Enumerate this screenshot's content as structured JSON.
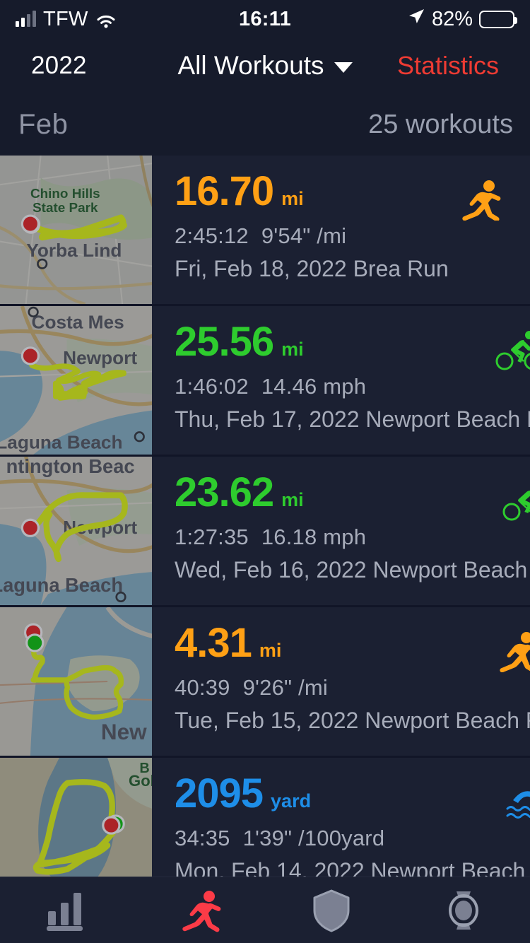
{
  "status_bar": {
    "carrier": "TFW",
    "time": "16:11",
    "battery_percent": "82%",
    "signal_icon": "cellular-bars-icon",
    "wifi_icon": "wifi-icon",
    "location_icon": "location-arrow-icon",
    "battery_icon": "battery-icon"
  },
  "nav": {
    "year": "2022",
    "title": "All Workouts",
    "dropdown_icon": "chevron-down-icon",
    "action": "Statistics",
    "action_color": "#EE3B33"
  },
  "section": {
    "month": "Feb",
    "count": "25 workouts"
  },
  "colors": {
    "run": "#FFA015",
    "bike": "#2ECC2E",
    "swim": "#1E8EE8",
    "accent_red": "#EE3B33",
    "route_track": "#E8FF1A",
    "page_bg": "#111527",
    "row_bg": "#1B2032",
    "bar_bg": "#161B2B",
    "secondary_text": "#A7ACBA"
  },
  "workouts": [
    {
      "distance": "16.70",
      "unit": "mi",
      "duration": "2:45:12",
      "pace": "9'54\" /mi",
      "date": "Fri, Feb 18, 2022",
      "name": "Brea Run",
      "sport": "run",
      "sport_icon": "running-icon",
      "map_labels": [
        "Chino Hills",
        "State Park",
        "Yorba Lind"
      ],
      "markers": [
        "red"
      ]
    },
    {
      "distance": "25.56",
      "unit": "mi",
      "duration": "1:46:02",
      "pace": "14.46 mph",
      "date": "Thu, Feb 17, 2022",
      "name": "Newport Beach Bike",
      "sport": "bike",
      "sport_icon": "cycling-icon",
      "map_labels": [
        "Costa Mes",
        "Newport",
        "Laguna Beach"
      ],
      "markers": [
        "red"
      ]
    },
    {
      "distance": "23.62",
      "unit": "mi",
      "duration": "1:27:35",
      "pace": "16.18 mph",
      "date": "Wed, Feb 16, 2022",
      "name": "Newport Beach Bike",
      "sport": "bike",
      "sport_icon": "cycling-icon",
      "map_labels": [
        "ntington Beac",
        "Newport",
        "Laguna Beach"
      ],
      "markers": [
        "red"
      ]
    },
    {
      "distance": "4.31",
      "unit": "mi",
      "duration": "40:39",
      "pace": "9'26\" /mi",
      "date": "Tue, Feb 15, 2022",
      "name": "Newport Beach Run",
      "sport": "run",
      "sport_icon": "running-icon",
      "map_labels": [
        "New"
      ],
      "markers": [
        "red",
        "green"
      ]
    },
    {
      "distance": "2095",
      "unit": "yard",
      "duration": "34:35",
      "pace": "1'39\" /100yard",
      "date": "Mon, Feb 14, 2022",
      "name": "Newport Beach Op...",
      "sport": "swim",
      "sport_icon": "swimming-icon",
      "map_labels": [
        "Gol"
      ],
      "markers": [
        "green",
        "red"
      ]
    }
  ],
  "tabs": [
    {
      "icon": "bar-chart-icon",
      "active": false
    },
    {
      "icon": "running-icon",
      "active": true
    },
    {
      "icon": "shield-icon",
      "active": false
    },
    {
      "icon": "watch-icon",
      "active": false
    }
  ]
}
